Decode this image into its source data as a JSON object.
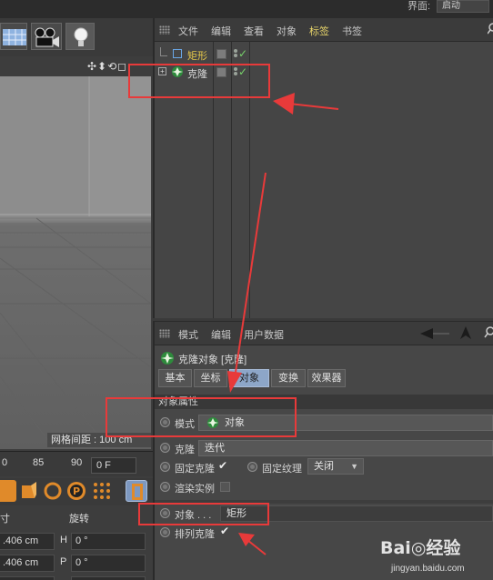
{
  "topbar": {
    "layout_label": "界面:",
    "layout_value": "启动"
  },
  "viewport": {
    "nav_icons": "✣⬍⟲◻",
    "grid_label": "网格间距 : 100 cm"
  },
  "timeline": {
    "ticks": [
      "0",
      "85",
      "90"
    ],
    "frame": "0 F"
  },
  "coords": {
    "header_size": "寸",
    "header_rotate": "旋转",
    "rows": [
      {
        "pos": ".406 cm",
        "axis": "H",
        "rot": "0 °"
      },
      {
        "pos": ".406 cm",
        "axis": "P",
        "rot": "0 °"
      }
    ]
  },
  "object_manager": {
    "menu": [
      "文件",
      "编辑",
      "查看",
      "对象",
      "标签",
      "书签"
    ],
    "active_menu": "标签",
    "objects": [
      {
        "name": "矩形",
        "color": "#e6c84a"
      },
      {
        "name": "克隆",
        "color": "#d8d8d8"
      }
    ]
  },
  "attribute_manager": {
    "menu": [
      "模式",
      "编辑",
      "用户数据"
    ],
    "title": "克隆对象 [克隆]",
    "tabs": [
      "基本",
      "坐标",
      "对象",
      "变换",
      "效果器"
    ],
    "active_tab": "对象",
    "section_title": "对象属性",
    "mode_label": "模式",
    "mode_value": "对象",
    "clone_label": "克隆",
    "clone_value": "迭代",
    "fix_clone_label": "固定克隆",
    "fix_texture_label": "固定纹理",
    "fix_texture_value": "关闭",
    "render_instance_label": "渲染实例",
    "object_label": "对象 . . .",
    "object_value": "矩形",
    "sort_clone_label": "排列克隆"
  },
  "watermark": {
    "main": "Bai◎经验",
    "sub": "jingyan.baidu.com"
  },
  "colors": {
    "annotation_red": "#e83a3a",
    "active_tab": "#8da6c8",
    "active_menu": "#e6d36a",
    "check_green": "#77d16a"
  }
}
